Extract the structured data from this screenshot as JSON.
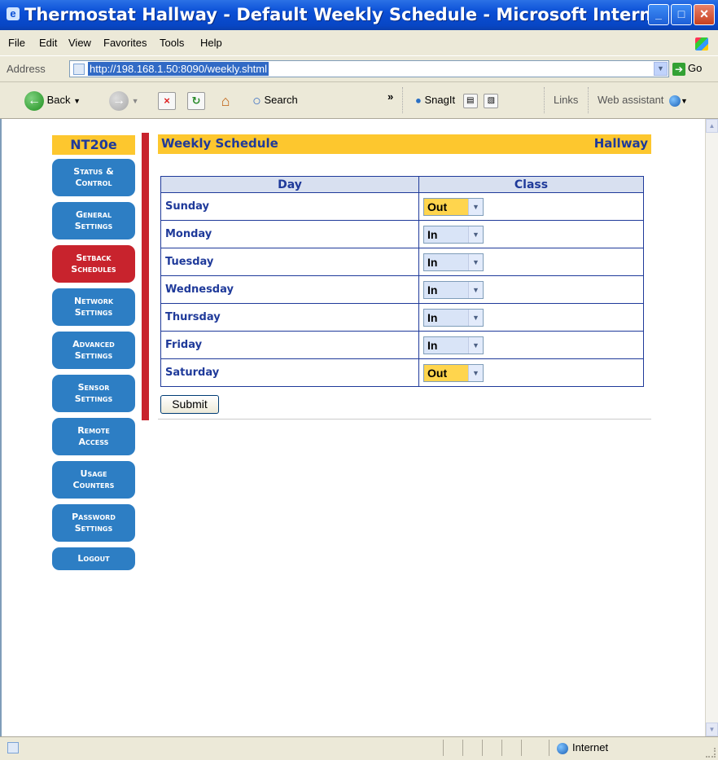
{
  "window": {
    "title": "Thermostat Hallway - Default Weekly Schedule - Microsoft Internet..."
  },
  "menu": [
    "File",
    "Edit",
    "View",
    "Favorites",
    "Tools",
    "Help"
  ],
  "address": {
    "label": "Address",
    "url": "http://198.168.1.50:8090/weekly.shtml",
    "go_label": "Go"
  },
  "toolbar": {
    "back_label": "Back",
    "search_label": "Search",
    "snagit_label": "SnagIt",
    "links_label": "Links",
    "web_assistant_label": "Web assistant"
  },
  "nav": {
    "brand": "NT20e",
    "items": [
      {
        "line1": "Status &",
        "line2": "Control"
      },
      {
        "line1": "General",
        "line2": "Settings"
      },
      {
        "line1": "Setback",
        "line2": "Schedules"
      },
      {
        "line1": "Network",
        "line2": "Settings"
      },
      {
        "line1": "Advanced",
        "line2": "Settings"
      },
      {
        "line1": "Sensor",
        "line2": "Settings"
      },
      {
        "line1": "Remote",
        "line2": "Access"
      },
      {
        "line1": "Usage",
        "line2": "Counters"
      },
      {
        "line1": "Password",
        "line2": "Settings"
      },
      {
        "line1": "Logout",
        "line2": ""
      }
    ],
    "active_index": 2
  },
  "content": {
    "heading": "Weekly Schedule",
    "thermostat_name": "Hallway",
    "columns": [
      "Day",
      "Class"
    ],
    "rows": [
      {
        "day": "Sunday",
        "class": "Out"
      },
      {
        "day": "Monday",
        "class": "In"
      },
      {
        "day": "Tuesday",
        "class": "In"
      },
      {
        "day": "Wednesday",
        "class": "In"
      },
      {
        "day": "Thursday",
        "class": "In"
      },
      {
        "day": "Friday",
        "class": "In"
      },
      {
        "day": "Saturday",
        "class": "Out"
      }
    ],
    "submit_label": "Submit"
  },
  "status": {
    "zone": "Internet"
  },
  "colors": {
    "accent_yellow": "#fdc72e",
    "nav_blue": "#2d7ec4",
    "nav_active_red": "#c8232d",
    "text_navy": "#1f3a9a"
  }
}
